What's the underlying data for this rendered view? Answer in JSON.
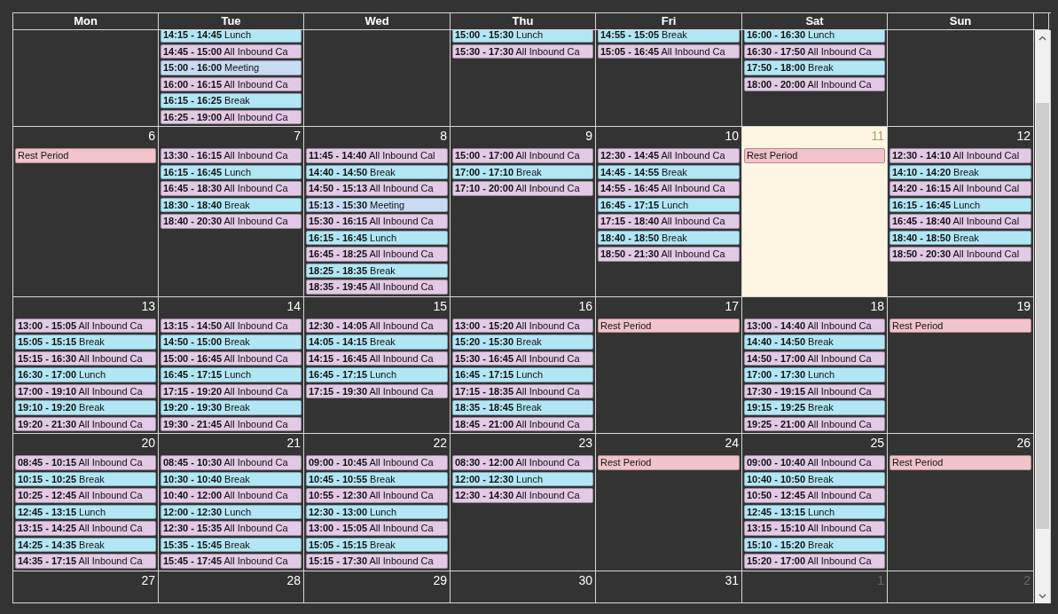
{
  "weekdays": [
    "Mon",
    "Tue",
    "Wed",
    "Thu",
    "Fri",
    "Sat",
    "Sun"
  ],
  "weeks": [
    {
      "days": [
        {
          "today": false
        },
        {
          "today": false,
          "events": [
            {
              "kind": "lunch",
              "text": "**14:15 - 14:45** Lunch"
            },
            {
              "kind": "call",
              "text": "**14:45 - 15:00** All Inbound Ca"
            },
            {
              "kind": "meeting",
              "text": "**15:00 - 16:00** Meeting"
            },
            {
              "kind": "call",
              "text": "**16:00 - 16:15** All Inbound Ca"
            },
            {
              "kind": "break",
              "text": "**16:15 - 16:25** Break"
            },
            {
              "kind": "call",
              "text": "**16:25 - 19:00** All Inbound Ca"
            }
          ]
        },
        {
          "today": false
        },
        {
          "today": false,
          "events": [
            {
              "kind": "lunch",
              "text": "**15:00 - 15:30** Lunch"
            },
            {
              "kind": "call",
              "text": "**15:30 - 17:30** All Inbound Ca"
            }
          ]
        },
        {
          "today": false,
          "events": [
            {
              "kind": "break",
              "text": "**14:55 - 15:05** Break"
            },
            {
              "kind": "call",
              "text": "**15:05 - 16:45** All Inbound Ca"
            }
          ]
        },
        {
          "today": false,
          "events": [
            {
              "kind": "lunch",
              "text": "**16:00 - 16:30** Lunch"
            },
            {
              "kind": "call",
              "text": "**16:30 - 17:50** All Inbound Ca"
            },
            {
              "kind": "break",
              "text": "**17:50 - 18:00** Break"
            },
            {
              "kind": "call",
              "text": "**18:00 - 20:00** All Inbound Ca"
            }
          ]
        },
        {
          "today": false
        }
      ]
    },
    {
      "days": [
        {
          "date": "6",
          "today": false,
          "other_month": false,
          "events": [
            {
              "kind": "rest",
              "text": "Rest Period"
            }
          ]
        },
        {
          "date": "7",
          "today": false,
          "other_month": false,
          "events": [
            {
              "kind": "call",
              "text": "**13:30 - 16:15** All Inbound Ca"
            },
            {
              "kind": "lunch",
              "text": "**16:15 - 16:45** Lunch"
            },
            {
              "kind": "call",
              "text": "**16:45 - 18:30** All Inbound Ca"
            },
            {
              "kind": "break",
              "text": "**18:30 - 18:40** Break"
            },
            {
              "kind": "call",
              "text": "**18:40 - 20:30** All Inbound Ca"
            }
          ]
        },
        {
          "date": "8",
          "today": false,
          "other_month": false,
          "events": [
            {
              "kind": "call",
              "text": "**11:45 - 14:40** All Inbound Cal"
            },
            {
              "kind": "break",
              "text": "**14:40 - 14:50** Break"
            },
            {
              "kind": "call",
              "text": "**14:50 - 15:13** All Inbound Ca"
            },
            {
              "kind": "meeting",
              "text": "**15:13 - 15:30** Meeting"
            },
            {
              "kind": "call",
              "text": "**15:30 - 16:15** All Inbound Ca"
            },
            {
              "kind": "lunch",
              "text": "**16:15 - 16:45** Lunch"
            },
            {
              "kind": "call",
              "text": "**16:45 - 18:25** All Inbound Ca"
            },
            {
              "kind": "break",
              "text": "**18:25 - 18:35** Break"
            },
            {
              "kind": "call",
              "text": "**18:35 - 19:45** All Inbound Ca"
            }
          ]
        },
        {
          "date": "9",
          "today": false,
          "other_month": false,
          "events": [
            {
              "kind": "call",
              "text": "**15:00 - 17:00** All Inbound Ca"
            },
            {
              "kind": "break",
              "text": "**17:00 - 17:10** Break"
            },
            {
              "kind": "call",
              "text": "**17:10 - 20:00** All Inbound Ca"
            }
          ]
        },
        {
          "date": "10",
          "today": false,
          "other_month": false,
          "events": [
            {
              "kind": "call",
              "text": "**12:30 - 14:45** All Inbound Ca"
            },
            {
              "kind": "break",
              "text": "**14:45 - 14:55** Break"
            },
            {
              "kind": "call",
              "text": "**14:55 - 16:45** All Inbound Ca"
            },
            {
              "kind": "lunch",
              "text": "**16:45 - 17:15** Lunch"
            },
            {
              "kind": "call",
              "text": "**17:15 - 18:40** All Inbound Ca"
            },
            {
              "kind": "break",
              "text": "**18:40 - 18:50** Break"
            },
            {
              "kind": "call",
              "text": "**18:50 - 21:30** All Inbound Ca"
            }
          ]
        },
        {
          "date": "11",
          "today": true,
          "other_month": false,
          "events": [
            {
              "kind": "rest",
              "text": "Rest Period"
            }
          ]
        },
        {
          "date": "12",
          "today": false,
          "other_month": false,
          "events": [
            {
              "kind": "call",
              "text": "**12:30 - 14:10** All Inbound Cal"
            },
            {
              "kind": "break",
              "text": "**14:10 - 14:20** Break"
            },
            {
              "kind": "call",
              "text": "**14:20 - 16:15** All Inbound Cal"
            },
            {
              "kind": "lunch",
              "text": "**16:15 - 16:45** Lunch"
            },
            {
              "kind": "call",
              "text": "**16:45 - 18:40** All Inbound Cal"
            },
            {
              "kind": "break",
              "text": "**18:40 - 18:50** Break"
            },
            {
              "kind": "call",
              "text": "**18:50 - 20:30** All Inbound Cal"
            }
          ]
        }
      ]
    },
    {
      "days": [
        {
          "date": "13",
          "today": false,
          "other_month": false,
          "events": [
            {
              "kind": "call",
              "text": "**13:00 - 15:05** All Inbound Ca"
            },
            {
              "kind": "break",
              "text": "**15:05 - 15:15** Break"
            },
            {
              "kind": "call",
              "text": "**15:15 - 16:30** All Inbound Ca"
            },
            {
              "kind": "lunch",
              "text": "**16:30 - 17:00** Lunch"
            },
            {
              "kind": "call",
              "text": "**17:00 - 19:10** All Inbound Ca"
            },
            {
              "kind": "break",
              "text": "**19:10 - 19:20** Break"
            },
            {
              "kind": "call",
              "text": "**19:20 - 21:30** All Inbound Ca"
            }
          ]
        },
        {
          "date": "14",
          "today": false,
          "other_month": false,
          "events": [
            {
              "kind": "call",
              "text": "**13:15 - 14:50** All Inbound Ca"
            },
            {
              "kind": "break",
              "text": "**14:50 - 15:00** Break"
            },
            {
              "kind": "call",
              "text": "**15:00 - 16:45** All Inbound Ca"
            },
            {
              "kind": "lunch",
              "text": "**16:45 - 17:15** Lunch"
            },
            {
              "kind": "call",
              "text": "**17:15 - 19:20** All Inbound Ca"
            },
            {
              "kind": "break",
              "text": "**19:20 - 19:30** Break"
            },
            {
              "kind": "call",
              "text": "**19:30 - 21:45** All Inbound Ca"
            }
          ]
        },
        {
          "date": "15",
          "today": false,
          "other_month": false,
          "events": [
            {
              "kind": "call",
              "text": "**12:30 - 14:05** All Inbound Ca"
            },
            {
              "kind": "break",
              "text": "**14:05 - 14:15** Break"
            },
            {
              "kind": "call",
              "text": "**14:15 - 16:45** All Inbound Ca"
            },
            {
              "kind": "lunch",
              "text": "**16:45 - 17:15** Lunch"
            },
            {
              "kind": "call",
              "text": "**17:15 - 19:30** All Inbound Ca"
            }
          ]
        },
        {
          "date": "16",
          "today": false,
          "other_month": false,
          "events": [
            {
              "kind": "call",
              "text": "**13:00 - 15:20** All Inbound Ca"
            },
            {
              "kind": "break",
              "text": "**15:20 - 15:30** Break"
            },
            {
              "kind": "call",
              "text": "**15:30 - 16:45** All Inbound Ca"
            },
            {
              "kind": "lunch",
              "text": "**16:45 - 17:15** Lunch"
            },
            {
              "kind": "call",
              "text": "**17:15 - 18:35** All Inbound Ca"
            },
            {
              "kind": "break",
              "text": "**18:35 - 18:45** Break"
            },
            {
              "kind": "call",
              "text": "**18:45 - 21:00** All Inbound Ca"
            }
          ]
        },
        {
          "date": "17",
          "today": false,
          "other_month": false,
          "events": [
            {
              "kind": "rest",
              "text": "Rest Period"
            }
          ]
        },
        {
          "date": "18",
          "today": false,
          "other_month": false,
          "events": [
            {
              "kind": "call",
              "text": "**13:00 - 14:40** All Inbound Ca"
            },
            {
              "kind": "break",
              "text": "**14:40 - 14:50** Break"
            },
            {
              "kind": "call",
              "text": "**14:50 - 17:00** All Inbound Ca"
            },
            {
              "kind": "lunch",
              "text": "**17:00 - 17:30** Lunch"
            },
            {
              "kind": "call",
              "text": "**17:30 - 19:15** All Inbound Ca"
            },
            {
              "kind": "break",
              "text": "**19:15 - 19:25** Break"
            },
            {
              "kind": "call",
              "text": "**19:25 - 21:00** All Inbound Ca"
            }
          ]
        },
        {
          "date": "19",
          "today": false,
          "other_month": false,
          "events": [
            {
              "kind": "rest",
              "text": "Rest Period"
            }
          ]
        }
      ]
    },
    {
      "days": [
        {
          "date": "20",
          "today": false,
          "other_month": false,
          "events": [
            {
              "kind": "call",
              "text": "**08:45 - 10:15** All Inbound Ca"
            },
            {
              "kind": "break",
              "text": "**10:15 - 10:25** Break"
            },
            {
              "kind": "call",
              "text": "**10:25 - 12:45** All Inbound Ca"
            },
            {
              "kind": "lunch",
              "text": "**12:45 - 13:15** Lunch"
            },
            {
              "kind": "call",
              "text": "**13:15 - 14:25** All Inbound Ca"
            },
            {
              "kind": "break",
              "text": "**14:25 - 14:35** Break"
            },
            {
              "kind": "call",
              "text": "**14:35 - 17:15** All Inbound Ca"
            }
          ]
        },
        {
          "date": "21",
          "today": false,
          "other_month": false,
          "events": [
            {
              "kind": "call",
              "text": "**08:45 - 10:30** All Inbound Ca"
            },
            {
              "kind": "break",
              "text": "**10:30 - 10:40** Break"
            },
            {
              "kind": "call",
              "text": "**10:40 - 12:00** All Inbound Ca"
            },
            {
              "kind": "lunch",
              "text": "**12:00 - 12:30** Lunch"
            },
            {
              "kind": "call",
              "text": "**12:30 - 15:35** All Inbound Ca"
            },
            {
              "kind": "break",
              "text": "**15:35 - 15:45** Break"
            },
            {
              "kind": "call",
              "text": "**15:45 - 17:45** All Inbound Ca"
            }
          ]
        },
        {
          "date": "22",
          "today": false,
          "other_month": false,
          "events": [
            {
              "kind": "call",
              "text": "**09:00 - 10:45** All Inbound Ca"
            },
            {
              "kind": "break",
              "text": "**10:45 - 10:55** Break"
            },
            {
              "kind": "call",
              "text": "**10:55 - 12:30** All Inbound Ca"
            },
            {
              "kind": "lunch",
              "text": "**12:30 - 13:00** Lunch"
            },
            {
              "kind": "call",
              "text": "**13:00 - 15:05** All Inbound Ca"
            },
            {
              "kind": "break",
              "text": "**15:05 - 15:15** Break"
            },
            {
              "kind": "call",
              "text": "**15:15 - 17:30** All Inbound Ca"
            }
          ]
        },
        {
          "date": "23",
          "today": false,
          "other_month": false,
          "events": [
            {
              "kind": "call",
              "text": "**08:30 - 12:00** All Inbound Ca"
            },
            {
              "kind": "lunch",
              "text": "**12:00 - 12:30** Lunch"
            },
            {
              "kind": "call",
              "text": "**12:30 - 14:30** All Inbound Ca"
            }
          ]
        },
        {
          "date": "24",
          "today": false,
          "other_month": false,
          "events": [
            {
              "kind": "rest",
              "text": "Rest Period"
            }
          ]
        },
        {
          "date": "25",
          "today": false,
          "other_month": false,
          "events": [
            {
              "kind": "call",
              "text": "**09:00 - 10:40** All Inbound Ca"
            },
            {
              "kind": "break",
              "text": "**10:40 - 10:50** Break"
            },
            {
              "kind": "call",
              "text": "**10:50 - 12:45** All Inbound Ca"
            },
            {
              "kind": "lunch",
              "text": "**12:45 - 13:15** Lunch"
            },
            {
              "kind": "call",
              "text": "**13:15 - 15:10** All Inbound Ca"
            },
            {
              "kind": "break",
              "text": "**15:10 - 15:20** Break"
            },
            {
              "kind": "call",
              "text": "**15:20 - 17:00** All Inbound Ca"
            }
          ]
        },
        {
          "date": "26",
          "today": false,
          "other_month": false,
          "events": [
            {
              "kind": "rest",
              "text": "Rest Period"
            }
          ]
        }
      ]
    },
    {
      "days": [
        {
          "date": "27",
          "today": false,
          "other_month": false
        },
        {
          "date": "28",
          "today": false,
          "other_month": false
        },
        {
          "date": "29",
          "today": false,
          "other_month": false
        },
        {
          "date": "30",
          "today": false,
          "other_month": false
        },
        {
          "date": "31",
          "today": false,
          "other_month": false
        },
        {
          "date": "1",
          "today": false,
          "other_month": true
        },
        {
          "date": "2",
          "today": false,
          "other_month": true
        }
      ]
    }
  ]
}
